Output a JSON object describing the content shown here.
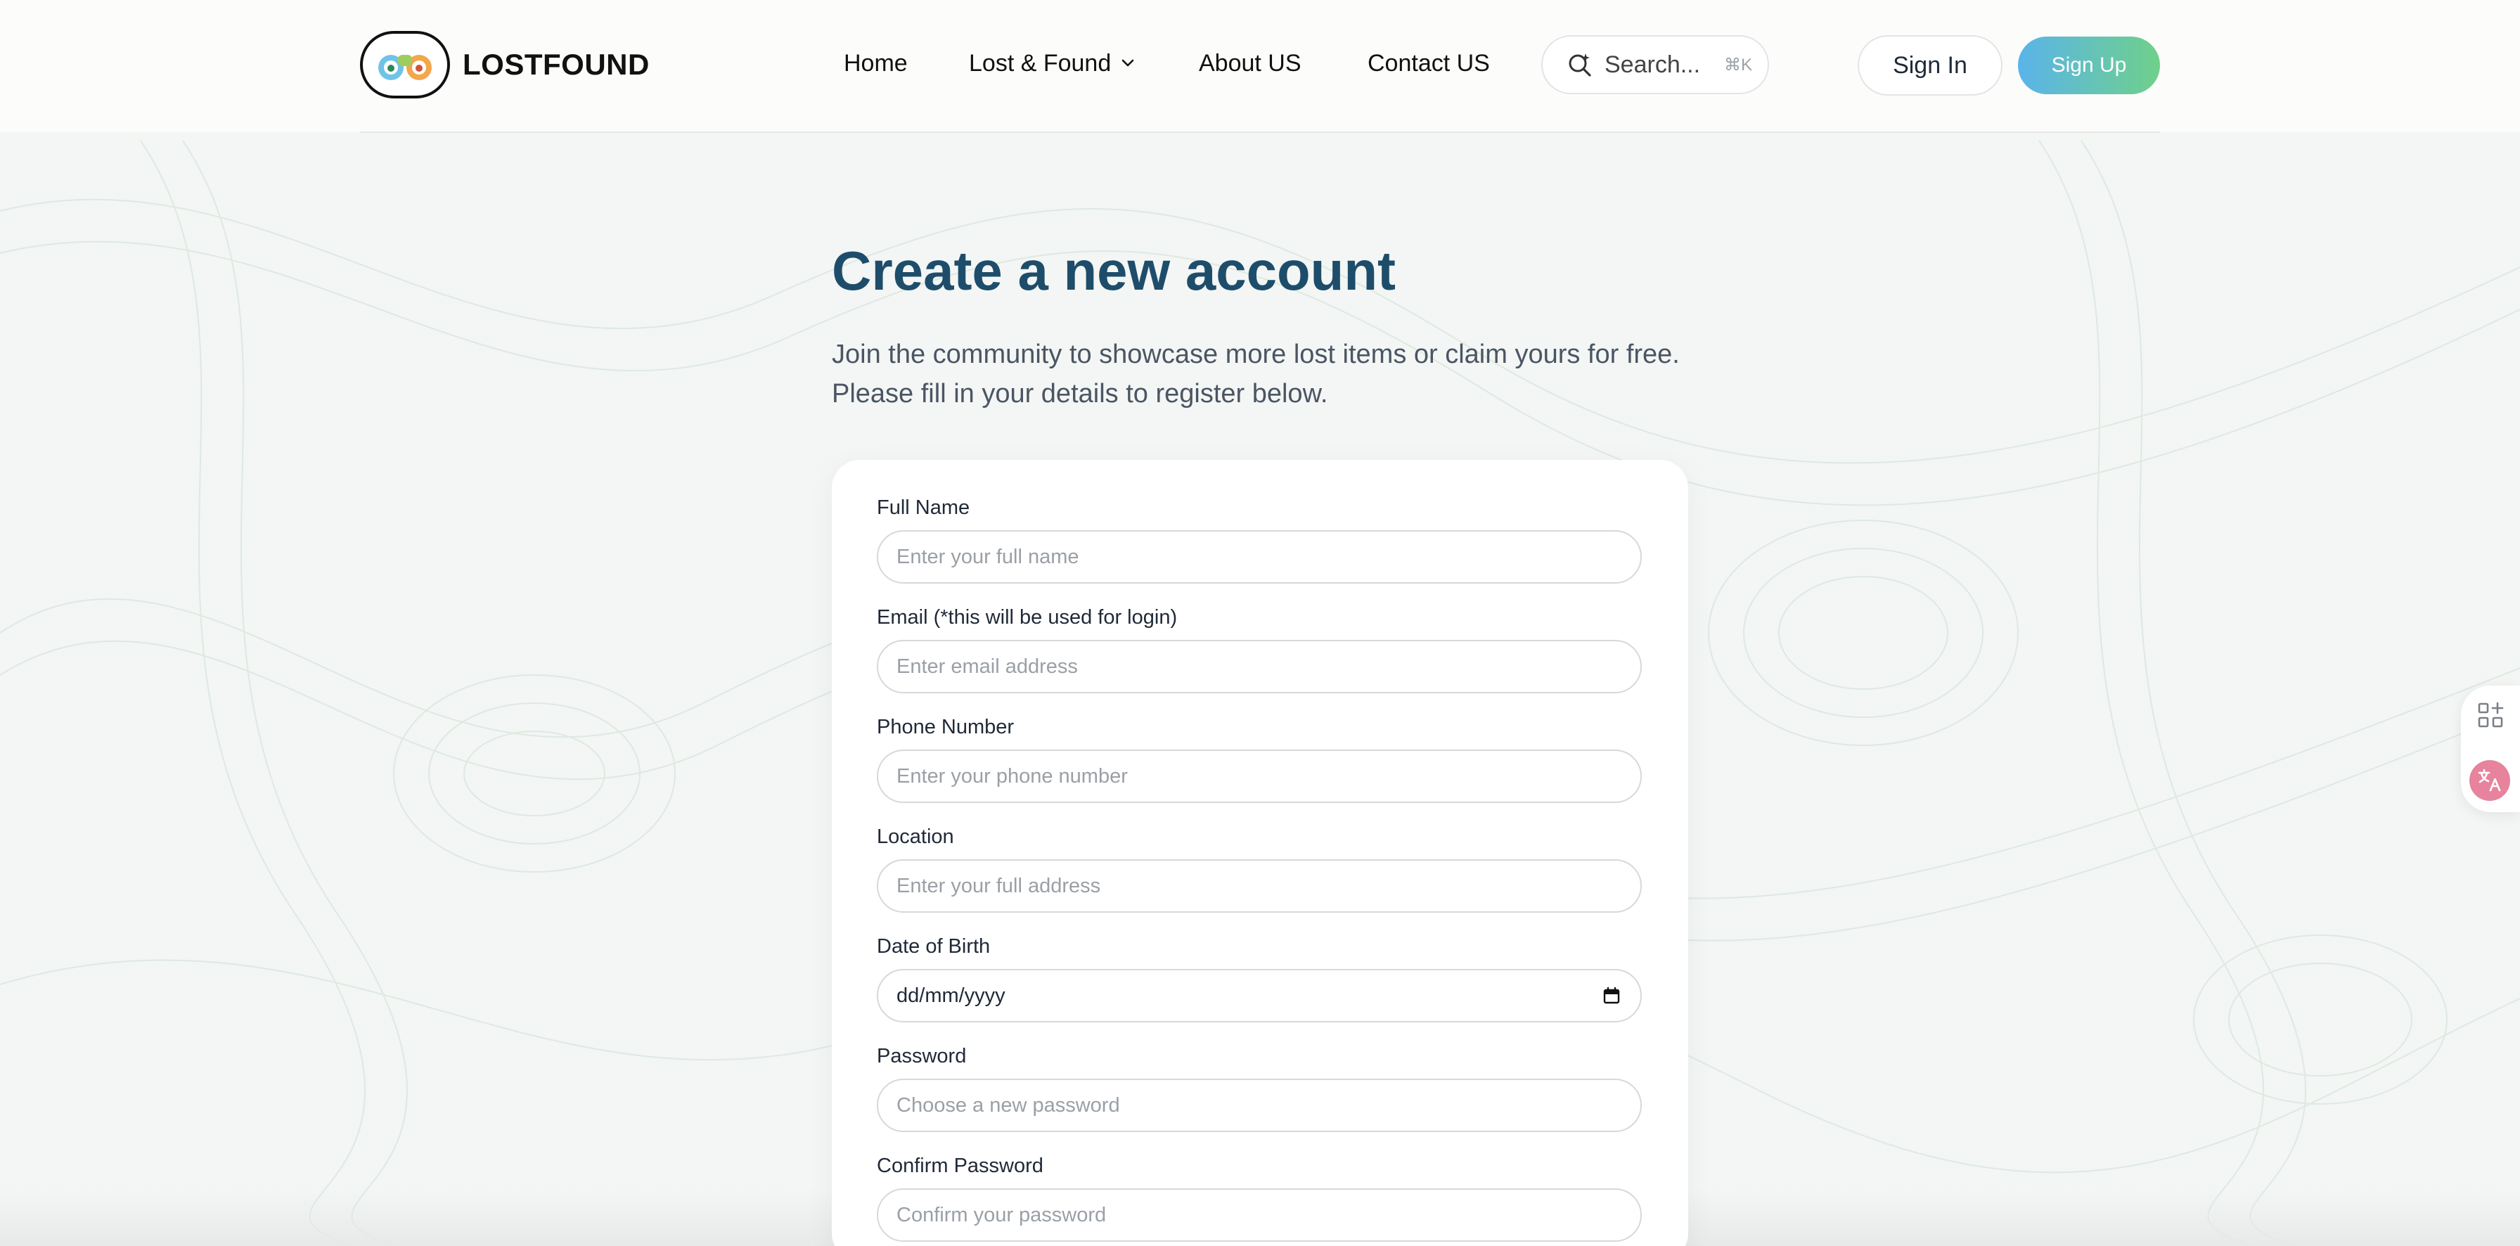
{
  "brand": {
    "name": "LOSTFOUND",
    "logo_icon": "binoculars-icon"
  },
  "nav": {
    "home": "Home",
    "lost_found": "Lost & Found",
    "about": "About US",
    "contact": "Contact US"
  },
  "search": {
    "placeholder": "Search...",
    "shortcut": "⌘K"
  },
  "auth": {
    "sign_in": "Sign In",
    "sign_up": "Sign Up"
  },
  "page": {
    "title": "Create a new account",
    "subtitle_line1": "Join the community to showcase more lost items or claim yours for free.",
    "subtitle_line2": "Please fill in your details to register below."
  },
  "form": {
    "full_name": {
      "label": "Full Name",
      "placeholder": "Enter your full name"
    },
    "email": {
      "label": "Email (*this will be used for login)",
      "placeholder": "Enter email address"
    },
    "phone": {
      "label": "Phone Number",
      "placeholder": "Enter your phone number"
    },
    "location": {
      "label": "Location",
      "placeholder": "Enter your full address"
    },
    "dob": {
      "label": "Date of Birth",
      "value": "dd/mm/yyyy"
    },
    "password": {
      "label": "Password",
      "placeholder": "Choose a new password"
    },
    "confirm_password": {
      "label": "Confirm Password",
      "placeholder": "Confirm your password"
    }
  },
  "colors": {
    "title": "#1e4d6b",
    "signup_gradient_start": "#5ab4ea",
    "signup_gradient_end": "#6fd08a",
    "translate_badge": "#e7839d"
  }
}
